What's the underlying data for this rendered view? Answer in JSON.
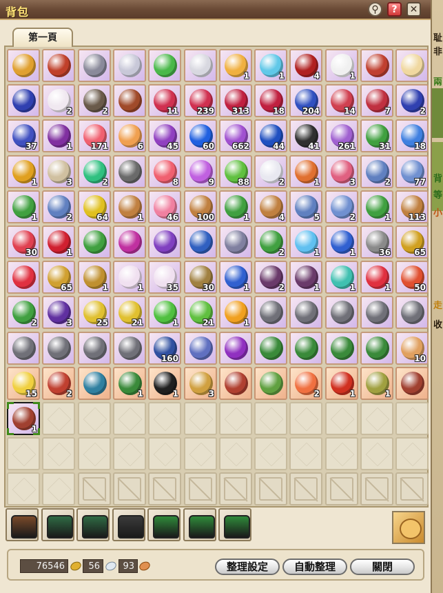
{
  "window": {
    "title": "背包"
  },
  "tabs": [
    {
      "label": "第一頁"
    }
  ],
  "peek_text": [
    "耻",
    "非",
    "兩",
    "背",
    "等",
    "小",
    "走",
    "收"
  ],
  "inventory": {
    "rows": [
      [
        {
          "n": "spear-icon",
          "c": "#e0a030",
          "q": ""
        },
        {
          "n": "red-cloak-icon",
          "c": "#c0402a",
          "q": ""
        },
        {
          "n": "silver-bracelet-icon",
          "c": "#8a8a9a",
          "q": ""
        },
        {
          "n": "ring-icon",
          "c": "#c8c8d8",
          "q": ""
        },
        {
          "n": "green-bangle-icon",
          "c": "#4ab84a",
          "q": ""
        },
        {
          "n": "silver-helm-icon",
          "c": "#d8d8e0",
          "q": ""
        },
        {
          "n": "rainbow-gem-icon",
          "c": "#f0b040",
          "q": "1"
        },
        {
          "n": "blue-crystal-icon",
          "c": "#60c8e8",
          "q": "1"
        },
        {
          "n": "berry-branch-icon",
          "c": "#b02020",
          "q": "4"
        },
        {
          "n": "white-horn-icon",
          "c": "#f0f0f0",
          "q": "1"
        },
        {
          "n": "red-cloth-icon",
          "c": "#c04030",
          "q": ""
        },
        {
          "n": "scroll-ticket-icon",
          "c": "#f0d8a0",
          "q": ""
        }
      ],
      [
        {
          "n": "blue-book-icon",
          "c": "#3040b0",
          "q": ""
        },
        {
          "n": "letter-scroll-icon",
          "c": "#f0e8f0",
          "q": "2"
        },
        {
          "n": "dark-book-icon",
          "c": "#6a5a4a",
          "q": "2"
        },
        {
          "n": "brown-book-icon",
          "c": "#a04a2a",
          "q": ""
        },
        {
          "n": "red-potion-icon",
          "c": "#d03050",
          "q": "11"
        },
        {
          "n": "red-potion-icon",
          "c": "#d03050",
          "q": "239"
        },
        {
          "n": "red-potion-icon",
          "c": "#c02040",
          "q": "313"
        },
        {
          "n": "red-potion-icon",
          "c": "#c02040",
          "q": "18"
        },
        {
          "n": "blue-potion-icon",
          "c": "#3050c0",
          "q": "204"
        },
        {
          "n": "red-potion-icon",
          "c": "#d04050",
          "q": "14"
        },
        {
          "n": "red-potion-icon",
          "c": "#c03040",
          "q": "7"
        },
        {
          "n": "blue-potion-icon",
          "c": "#3040b0",
          "q": "2"
        }
      ],
      [
        {
          "n": "blue-potion-icon",
          "c": "#4050c0",
          "q": "37"
        },
        {
          "n": "crown-icon",
          "c": "#8030a0",
          "q": "1"
        },
        {
          "n": "pink-orb-icon",
          "c": "#f06070",
          "q": "171"
        },
        {
          "n": "rainbow-egg-icon",
          "c": "#f0a050",
          "q": "6"
        },
        {
          "n": "purple-sparkle-icon",
          "c": "#9040c0",
          "q": "45"
        },
        {
          "n": "blue-flame-icon",
          "c": "#2060e0",
          "q": "60"
        },
        {
          "n": "purple-sparkle-icon",
          "c": "#a050d0",
          "q": "662"
        },
        {
          "n": "blue-flame-icon",
          "c": "#2050c0",
          "q": "44"
        },
        {
          "n": "dark-disc-icon",
          "c": "#303030",
          "q": "41"
        },
        {
          "n": "purple-sparkle-icon",
          "c": "#a060d0",
          "q": "261"
        },
        {
          "n": "green-leaf-ball-icon",
          "c": "#40a040",
          "q": "31"
        },
        {
          "n": "blue-flame-icon",
          "c": "#4080e0",
          "q": "18"
        }
      ],
      [
        {
          "n": "gold-coin-icon",
          "c": "#e0a020",
          "q": "1"
        },
        {
          "n": "wand-icon",
          "c": "#d0c0a0",
          "q": "3"
        },
        {
          "n": "green-orb-icon",
          "c": "#30c080",
          "q": "2"
        },
        {
          "n": "stone-tablet-icon",
          "c": "#6a6a6a",
          "q": ""
        },
        {
          "n": "pink-orb-icon",
          "c": "#f06070",
          "q": "8"
        },
        {
          "n": "violet-orb-icon",
          "c": "#c060e0",
          "q": "9"
        },
        {
          "n": "green-flask-icon",
          "c": "#60c040",
          "q": "88"
        },
        {
          "n": "white-diamond-icon",
          "c": "#e8e8f0",
          "q": "2"
        },
        {
          "n": "fox-mask-icon",
          "c": "#e07030",
          "q": "1"
        },
        {
          "n": "fox-mask-icon",
          "c": "#e06080",
          "q": "3"
        },
        {
          "n": "blue-bell-icon",
          "c": "#6080c0",
          "q": "2"
        },
        {
          "n": "blue-bell-icon",
          "c": "#7090d0",
          "q": "77"
        }
      ],
      [
        {
          "n": "green-leaf-ball-icon",
          "c": "#40a040",
          "q": "1"
        },
        {
          "n": "blue-bell-icon",
          "c": "#6080c0",
          "q": "2"
        },
        {
          "n": "gold-coin-icon",
          "c": "#e0c020",
          "q": "64"
        },
        {
          "n": "pentagram-cookie-icon",
          "c": "#c08040",
          "q": "1"
        },
        {
          "n": "lollipop-icon",
          "c": "#f080a0",
          "q": "46"
        },
        {
          "n": "pentagram-cookie-icon",
          "c": "#c08040",
          "q": "100"
        },
        {
          "n": "green-leaf-ball-icon",
          "c": "#40a040",
          "q": "1"
        },
        {
          "n": "pentagram-cookie-icon",
          "c": "#c08040",
          "q": "4"
        },
        {
          "n": "blue-bell-icon",
          "c": "#6080c0",
          "q": "5"
        },
        {
          "n": "blue-bell-icon",
          "c": "#7090d0",
          "q": "2"
        },
        {
          "n": "green-leaf-ball-icon",
          "c": "#40a040",
          "q": "1"
        },
        {
          "n": "pentagram-cookie-icon",
          "c": "#c08040",
          "q": "113"
        }
      ],
      [
        {
          "n": "ribbon-wand-icon",
          "c": "#e04050",
          "q": "30"
        },
        {
          "n": "red-rose-icon",
          "c": "#d02030",
          "q": "1"
        },
        {
          "n": "green-door-icon",
          "c": "#40a040",
          "q": ""
        },
        {
          "n": "magenta-door-icon",
          "c": "#c030a0",
          "q": ""
        },
        {
          "n": "purple-door-icon",
          "c": "#8040c0",
          "q": ""
        },
        {
          "n": "blue-door-icon",
          "c": "#3060c0",
          "q": ""
        },
        {
          "n": "gray-door-icon",
          "c": "#8080a0",
          "q": ""
        },
        {
          "n": "green-card-icon",
          "c": "#40a040",
          "q": "2"
        },
        {
          "n": "ice-cube-icon",
          "c": "#60c0f0",
          "q": "1"
        },
        {
          "n": "blue-bottle-icon",
          "c": "#3060d0",
          "q": "1"
        },
        {
          "n": "gray-stone-icon",
          "c": "#8a8a8a",
          "q": "36"
        },
        {
          "n": "gold-shield-icon",
          "c": "#d0a020",
          "q": "65"
        }
      ],
      [
        {
          "n": "red-crystal-icon",
          "c": "#e03040",
          "q": ""
        },
        {
          "n": "gold-nuggets-icon",
          "c": "#d0a030",
          "q": "65"
        },
        {
          "n": "gold-nuggets-icon",
          "c": "#c09030",
          "q": "1"
        },
        {
          "n": "scroll-icon",
          "c": "#f0e0f0",
          "q": "1"
        },
        {
          "n": "scroll-icon",
          "c": "#f0e0f0",
          "q": "35"
        },
        {
          "n": "brown-pouch-icon",
          "c": "#a08040",
          "q": "30"
        },
        {
          "n": "blue-bottle-icon",
          "c": "#3060d0",
          "q": "1"
        },
        {
          "n": "mystery-bag-icon",
          "c": "#6a3a6a",
          "q": "2"
        },
        {
          "n": "mystery-bag-icon",
          "c": "#6a3a6a",
          "q": "1"
        },
        {
          "n": "gift-box-icon",
          "c": "#40c0b0",
          "q": "1"
        },
        {
          "n": "red-hourglass-icon",
          "c": "#e03040",
          "q": "1"
        },
        {
          "n": "red-hourglass-icon",
          "c": "#e05030",
          "q": "50"
        }
      ],
      [
        {
          "n": "clover-icon",
          "c": "#40a040",
          "q": "2"
        },
        {
          "n": "purple-box-icon",
          "c": "#6030a0",
          "q": "3"
        },
        {
          "n": "yellow-hourglass-icon",
          "c": "#e0c030",
          "q": "25"
        },
        {
          "n": "yellow-hourglass-icon",
          "c": "#e0c030",
          "q": "21"
        },
        {
          "n": "green-hourglass-icon",
          "c": "#50c040",
          "q": "1"
        },
        {
          "n": "green-hourglass-icon",
          "c": "#60c040",
          "q": "21"
        },
        {
          "n": "fire-hourglass-icon",
          "c": "#f0a020",
          "q": "1"
        },
        {
          "n": "gray-leaf-icon",
          "c": "#707078",
          "q": ""
        },
        {
          "n": "gray-leaf-icon",
          "c": "#707078",
          "q": ""
        },
        {
          "n": "gray-leaf-icon",
          "c": "#707078",
          "q": ""
        },
        {
          "n": "gray-leaf-icon",
          "c": "#707078",
          "q": ""
        },
        {
          "n": "gray-leaf-icon",
          "c": "#707078",
          "q": ""
        }
      ],
      [
        {
          "n": "gray-leaf-icon",
          "c": "#707078",
          "q": ""
        },
        {
          "n": "gray-leaf-icon",
          "c": "#707078",
          "q": ""
        },
        {
          "n": "gray-leaf-icon",
          "c": "#707078",
          "q": ""
        },
        {
          "n": "gray-leaf-icon",
          "c": "#707078",
          "q": ""
        },
        {
          "n": "blue-crystal-shard-icon",
          "c": "#3050a0",
          "q": "160"
        },
        {
          "n": "clock-medal-icon",
          "c": "#6070c0",
          "q": ""
        },
        {
          "n": "purple-orb-icon",
          "c": "#9030c0",
          "q": ""
        },
        {
          "n": "green-card-icon",
          "c": "#3a8a3a",
          "q": ""
        },
        {
          "n": "green-card-icon",
          "c": "#3a8a3a",
          "q": ""
        },
        {
          "n": "green-card-icon",
          "c": "#3a8a3a",
          "q": ""
        },
        {
          "n": "green-card-icon",
          "c": "#3a8a3a",
          "q": ""
        },
        {
          "n": "flower-scroll-icon",
          "c": "#e0a060",
          "q": "10"
        }
      ],
      [
        {
          "n": "rainbow-star-icon",
          "c": "#f0d040",
          "q": "15",
          "bg": "orange"
        },
        {
          "n": "red-sword-icon",
          "c": "#c04030",
          "q": "2",
          "bg": "orange"
        },
        {
          "n": "teal-dress-icon",
          "c": "#3080a0",
          "q": "",
          "bg": "orange"
        },
        {
          "n": "green-cucumber-icon",
          "c": "#3a8a3a",
          "q": "1",
          "bg": "orange"
        },
        {
          "n": "black-stone-icon",
          "c": "#202020",
          "q": "1",
          "bg": "orange"
        },
        {
          "n": "gold-sack-icon",
          "c": "#d0a040",
          "q": "3",
          "bg": "orange"
        },
        {
          "n": "meat-icon",
          "c": "#b04030",
          "q": "",
          "bg": "orange"
        },
        {
          "n": "bamboo-icon",
          "c": "#60a040",
          "q": "",
          "bg": "orange"
        },
        {
          "n": "salmon-icon",
          "c": "#f07040",
          "q": "2",
          "bg": "orange"
        },
        {
          "n": "tomato-bowl-icon",
          "c": "#d03020",
          "q": "1",
          "bg": "orange"
        },
        {
          "n": "rice-plant-icon",
          "c": "#a0a040",
          "q": "1",
          "bg": "orange"
        },
        {
          "n": "meat-icon",
          "c": "#a04030",
          "q": "",
          "bg": "orange"
        }
      ],
      [
        {
          "n": "meat-icon",
          "c": "#a04030",
          "q": "1",
          "bg": "filled",
          "sel": true
        }
      ]
    ]
  },
  "bags": [
    {
      "n": "brown-backpack-icon",
      "c": "#7a4a2a"
    },
    {
      "n": "green-backpack-icon",
      "c": "#2f6a44"
    },
    {
      "n": "green-backpack-icon",
      "c": "#2f6a44"
    },
    {
      "n": "dark-backpack-icon",
      "c": "#3a3a3a"
    },
    {
      "n": "green-pouch-icon",
      "c": "#2f8a3a"
    },
    {
      "n": "green-pouch-icon",
      "c": "#2f8a3a"
    },
    {
      "n": "green-pouch-icon",
      "c": "#2f8a3a"
    }
  ],
  "currency": {
    "gold": "76546",
    "silver": "56",
    "bronze": "93"
  },
  "buttons": {
    "sort_settings": "整理設定",
    "auto_sort": "自動整理",
    "close": "關閉"
  }
}
